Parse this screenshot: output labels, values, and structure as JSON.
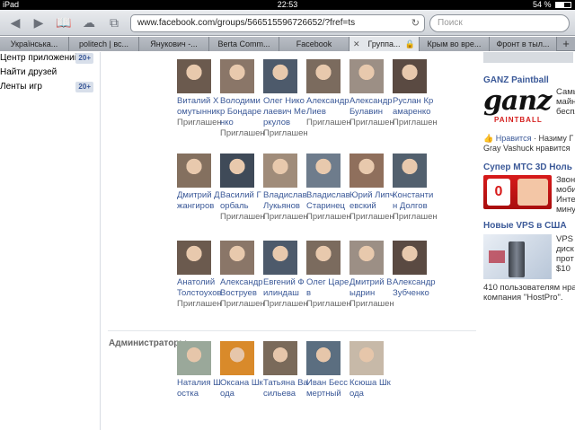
{
  "status_bar": {
    "device": "iPad",
    "time": "22:53",
    "battery": "54 %",
    "battery_level": 0.54
  },
  "toolbar": {
    "url": "www.facebook.com/groups/566515596726652/?fref=ts",
    "search_placeholder": "Поиск"
  },
  "tabs": [
    {
      "label": "Українська..."
    },
    {
      "label": "politech | вс..."
    },
    {
      "label": "Янукович -..."
    },
    {
      "label": "Berta Comm..."
    },
    {
      "label": "Facebook"
    },
    {
      "label": "Группа..."
    },
    {
      "label": "Крым во вре..."
    },
    {
      "label": "Фронт в тыл..."
    }
  ],
  "sidebar": {
    "items": [
      {
        "label": "Центр приложений",
        "badge": "20+"
      },
      {
        "label": "Найти друзей",
        "badge": ""
      },
      {
        "label": "Ленты игр",
        "badge": "20+"
      }
    ]
  },
  "members": [
    {
      "name": "Виталий Хомутынник",
      "status": "Приглашен"
    },
    {
      "name": "Володимир Бондаренко",
      "status": "Приглашен"
    },
    {
      "name": "Олег Николаевич Меркулов",
      "status": "Приглашен"
    },
    {
      "name": "Александр Лиев",
      "status": "Приглашен"
    },
    {
      "name": "Александр Булавин",
      "status": "Приглашен"
    },
    {
      "name": "Руслан Крамаренко",
      "status": "Приглашен"
    },
    {
      "name": "Дмитрий Джангиров",
      "status": ""
    },
    {
      "name": "Василий Горбаль",
      "status": "Приглашен"
    },
    {
      "name": "Владислав Лукьянов",
      "status": "Приглашен"
    },
    {
      "name": "Владислав Старинец",
      "status": "Приглашен"
    },
    {
      "name": "Юрий Липчевский",
      "status": "Приглашен"
    },
    {
      "name": "Константин Долгов",
      "status": "Приглашен"
    },
    {
      "name": "Анатолий Толстоухов",
      "status": "Приглашен"
    },
    {
      "name": "Александр Воструев",
      "status": "Приглашен"
    },
    {
      "name": "Евгений Филиндаш",
      "status": "Приглашен"
    },
    {
      "name": "Олег Царев",
      "status": "Приглашен"
    },
    {
      "name": "Дмитрий Выдрин",
      "status": "Приглашен"
    },
    {
      "name": "Александр Зубченко",
      "status": ""
    }
  ],
  "admins_label": "Администраторы",
  "admins": [
    {
      "name": "Наталия Шостка"
    },
    {
      "name": "Оксана Шкода"
    },
    {
      "name": "Татьяна Васильева"
    },
    {
      "name": "Иван Бессмертный"
    },
    {
      "name": "Ксюша Шкода"
    }
  ],
  "ads": {
    "ganz": {
      "title": "GANZ Paintball",
      "logo_text": "ganz",
      "logo_sub": "PAINTBALL",
      "lines": [
        "Самы",
        "майн",
        "беспл"
      ],
      "like_label": "Нравится",
      "like_dot": "·",
      "liked_by_1": "Назиму Г",
      "liked_by_2": "Gray Vashuck нравится"
    },
    "mts": {
      "title": "Супер МТС 3D Ноль 2",
      "lines": [
        "Звонк",
        "мобил",
        "Интер",
        "минут"
      ]
    },
    "vps": {
      "title": "Новые VPS в США",
      "lines": [
        "VPS",
        "диск",
        "прот",
        "$10"
      ],
      "footer_1": "410 пользователям нра",
      "footer_2": "компания \"HostPro\"."
    }
  }
}
